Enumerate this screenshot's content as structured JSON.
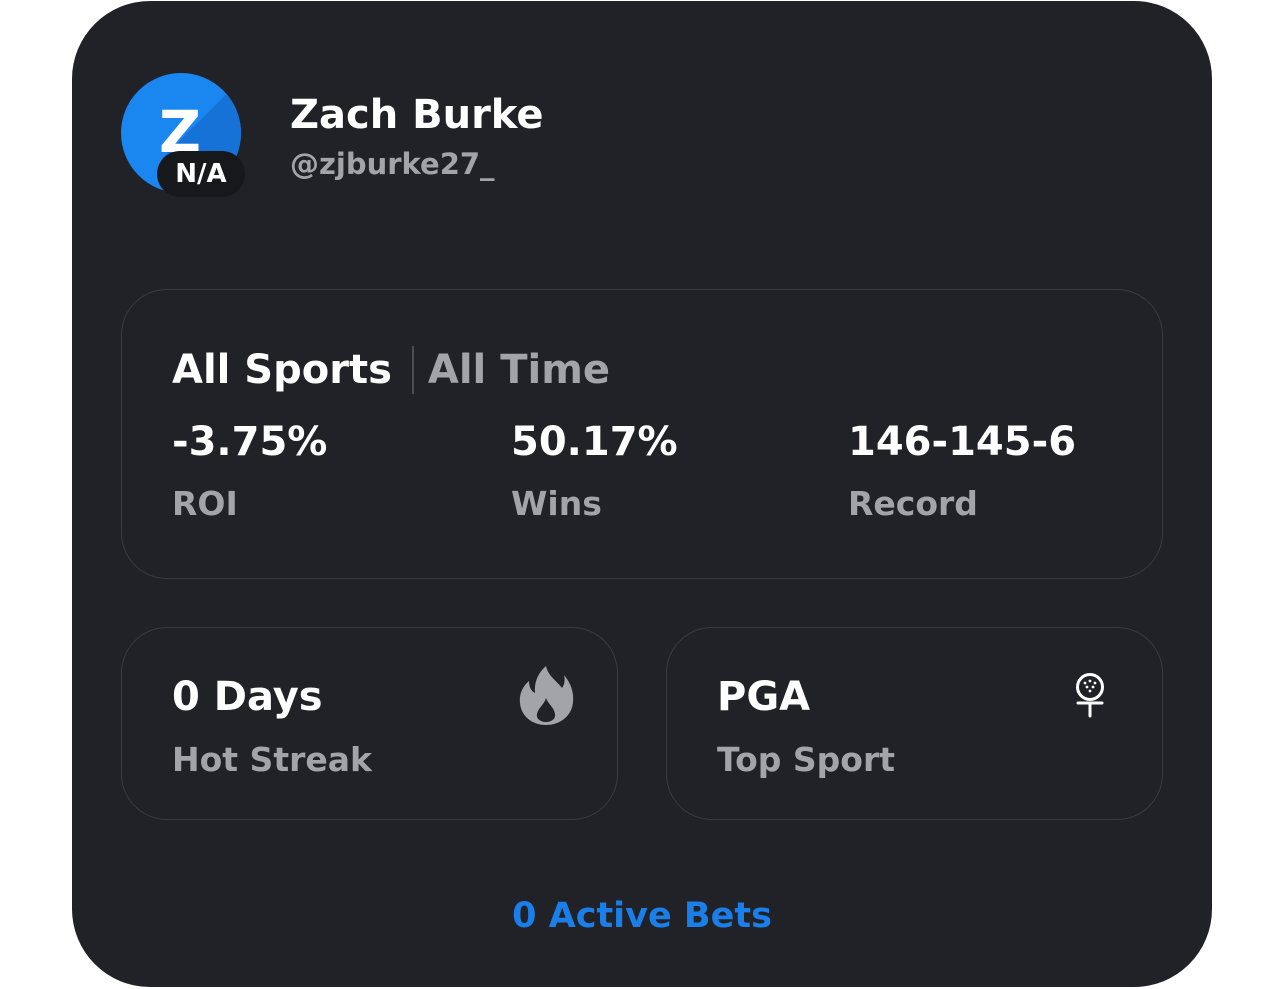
{
  "profile": {
    "avatar_initial": "Z",
    "badge": "N/A",
    "name": "Zach Burke",
    "handle": "@zjburke27_"
  },
  "filters": {
    "sport": "All Sports",
    "time": "All Time"
  },
  "stats": [
    {
      "value": "-3.75%",
      "label": "ROI"
    },
    {
      "value": "50.17%",
      "label": "Wins"
    },
    {
      "value": "146-145-6",
      "label": "Record"
    }
  ],
  "streak": {
    "value": "0 Days",
    "label": "Hot Streak",
    "icon": "fire-icon"
  },
  "top_sport": {
    "value": "PGA",
    "label": "Top Sport",
    "icon": "golf-ball-tee-icon"
  },
  "active_bets": "0 Active Bets",
  "colors": {
    "card_bg": "#212228",
    "accent": "#1a7fe8",
    "avatar_bg": "#1a86f0",
    "muted_text": "#a2a4aa"
  }
}
